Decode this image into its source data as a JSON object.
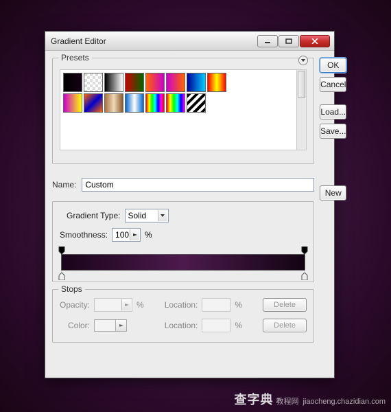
{
  "window": {
    "title": "Gradient Editor"
  },
  "buttons": {
    "ok": "OK",
    "cancel": "Cancel",
    "load": "Load...",
    "save": "Save...",
    "new": "New",
    "delete": "Delete"
  },
  "presets": {
    "label": "Presets",
    "swatches": [
      "linear-gradient(to right,#000,#160216)",
      "repeating-conic-gradient(#fff 0 25%, #ddd 0 50%) 0 0/8px 8px",
      "linear-gradient(to right,#000,#fff)",
      "linear-gradient(to right,#c00,#060)",
      "linear-gradient(to right,#f60,#c0c)",
      "linear-gradient(to right,#c0c,#f60)",
      "linear-gradient(to right,#009,#0cf)",
      "linear-gradient(to right,#f00,#ff0,#f00)",
      "linear-gradient(to right,#c0c,#ff0)",
      "linear-gradient(135deg,#f60,#00c,#f60)",
      "linear-gradient(to right,#a97142,#efd9b8,#8a5a2b)",
      "linear-gradient(to right,#06c,#fff,#06c)",
      "linear-gradient(to right,#f00,#ff0,#0f0,#0ff,#00f,#f0f,#f00)",
      "linear-gradient(to right,#f00,#ff0,#0f0,#0ff,#00f,#f0f)",
      "repeating-linear-gradient(135deg,#000 0 4px,#fff 4px 8px)"
    ]
  },
  "name": {
    "label": "Name:",
    "value": "Custom"
  },
  "gradType": {
    "label": "Gradient Type:",
    "value": "Solid"
  },
  "smooth": {
    "label": "Smoothness:",
    "value": "100",
    "suffix": "%"
  },
  "stops": {
    "label": "Stops",
    "opacityLabel": "Opacity:",
    "colorLabel": "Color:",
    "locationLabel": "Location:",
    "pct": "%"
  },
  "watermark": {
    "brand": "查字典",
    "sub": "教程网",
    "url": "jiaocheng.chazidian.com"
  }
}
